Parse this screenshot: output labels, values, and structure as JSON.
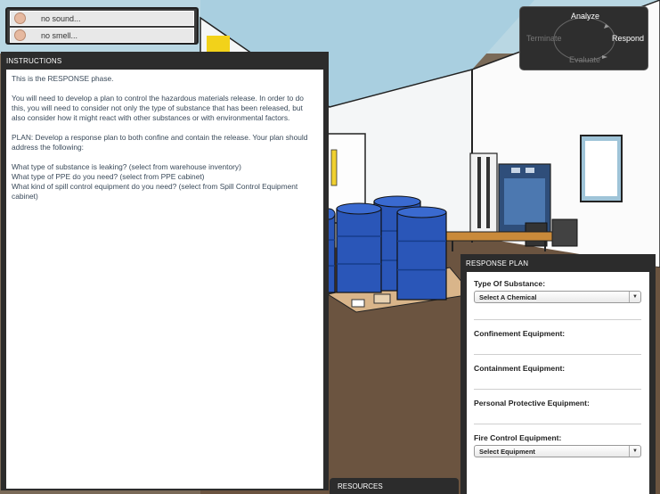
{
  "senses": [
    {
      "icon": "face-icon",
      "label": "no sound..."
    },
    {
      "icon": "face-icon",
      "label": "no smell..."
    }
  ],
  "phases": {
    "analyze": "Analyze",
    "respond": "Respond",
    "evaluate": "Evaluate",
    "terminate": "Terminate",
    "active": "Respond"
  },
  "instructions": {
    "header": "INSTRUCTIONS",
    "paragraphs": [
      "This is the RESPONSE phase.",
      "You will need to develop a plan to control the hazardous materials release. In order to do this, you will need to consider not only the type of substance that has been released, but also consider how it might react with other substances or with environmental factors.",
      "PLAN:  Develop a response plan to both confine and contain the release. Your plan should address the following:"
    ],
    "questions": [
      "What type of substance is leaking? (select from warehouse inventory)",
      "What type of PPE do you need? (select from PPE cabinet)",
      "What kind of spill control equipment do you need? (select from Spill Control Equipment cabinet)"
    ]
  },
  "response_plan": {
    "header": "RESPONSE PLAN",
    "type_of_substance": {
      "label": "Type Of Substance:",
      "value": "Select A Chemical"
    },
    "confinement_label": "Confinement Equipment:",
    "containment_label": "Containment Equipment:",
    "ppe_label": "Personal Protective Equipment:",
    "fire_control": {
      "label": "Fire Control Equipment:",
      "value": "Select Equipment"
    }
  },
  "resources": {
    "label": "RESOURCES"
  },
  "colors": {
    "panel": "#2c2c2c",
    "barrel": "#2a56b8",
    "floor": "#6b5440",
    "wall": "#ffffff"
  }
}
